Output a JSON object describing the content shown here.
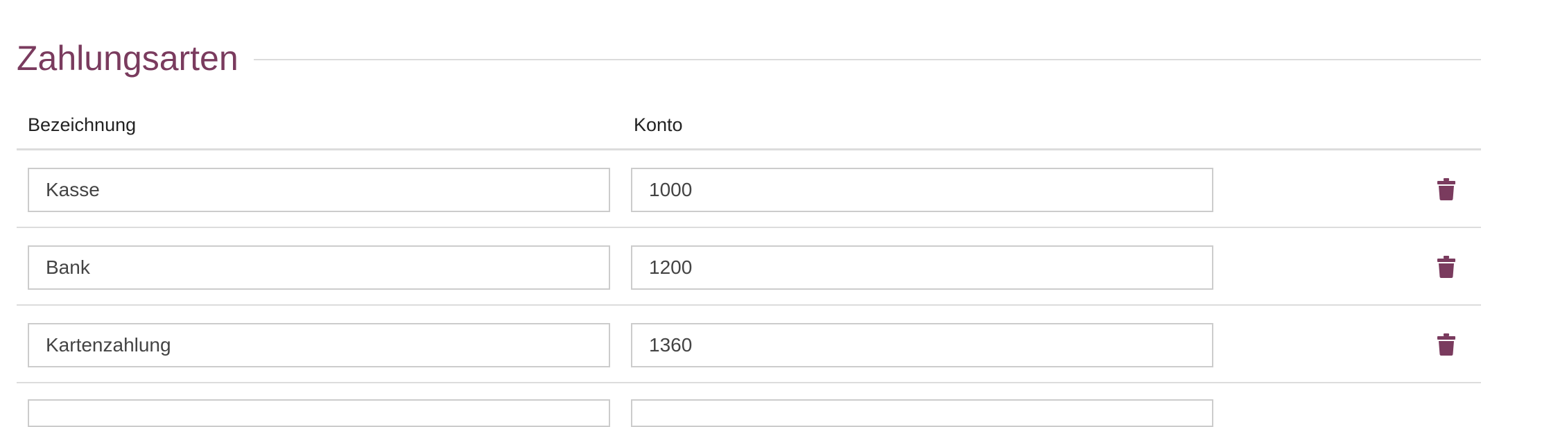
{
  "section": {
    "title": "Zahlungsarten"
  },
  "table": {
    "columns": {
      "name": "Bezeichnung",
      "account": "Konto"
    },
    "rows": [
      {
        "name": "Kasse",
        "account": "1000"
      },
      {
        "name": "Bank",
        "account": "1200"
      },
      {
        "name": "Kartenzahlung",
        "account": "1360"
      }
    ]
  },
  "colors": {
    "accent": "#7a3b5e",
    "rule": "#dcdcdc",
    "field_border": "#cccccc"
  },
  "icons": {
    "delete": "trash-icon"
  }
}
